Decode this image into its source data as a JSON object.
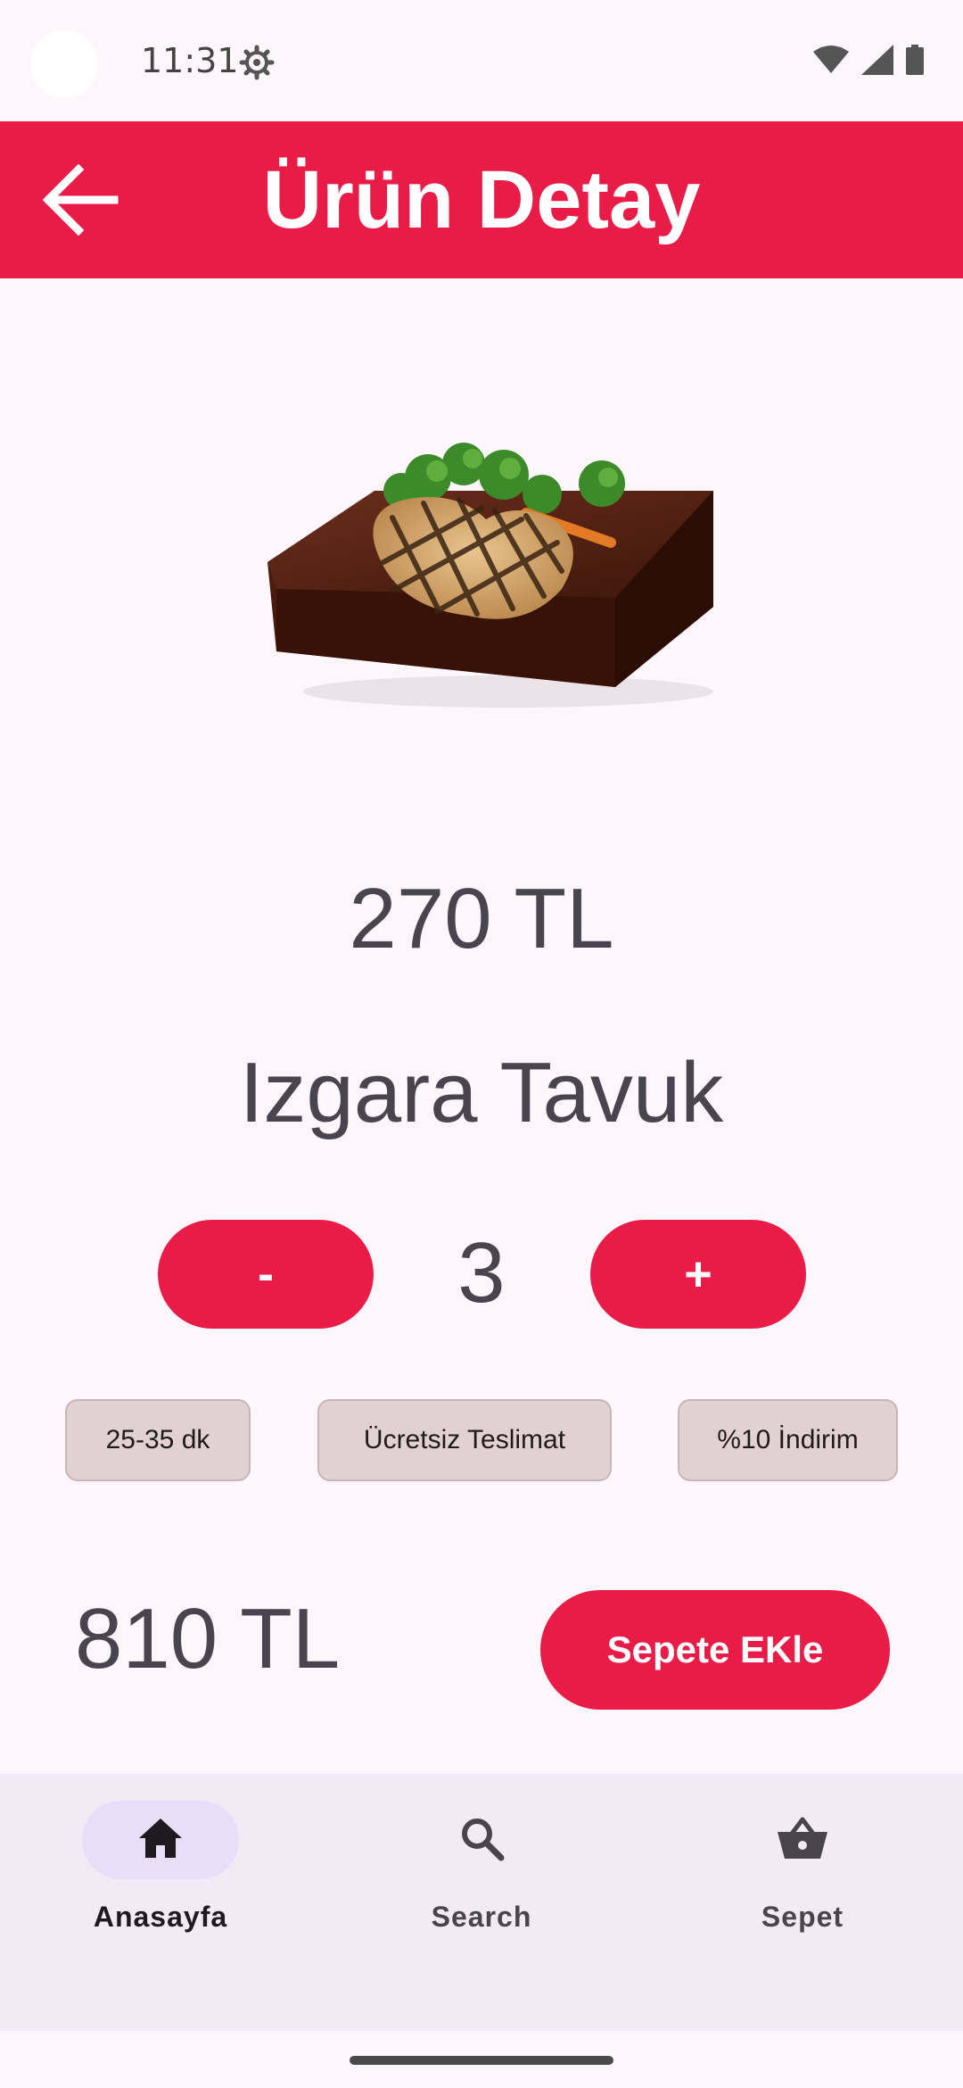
{
  "status_bar": {
    "time": "11:31"
  },
  "app_bar": {
    "title": "Ürün Detay"
  },
  "product": {
    "price": "270 TL",
    "name": "Izgara Tavuk",
    "quantity": "3"
  },
  "stepper": {
    "minus_label": "-",
    "plus_label": "+"
  },
  "chips": [
    {
      "label": "25-35 dk"
    },
    {
      "label": "Ücretsiz Teslimat"
    },
    {
      "label": "%10 İndirim"
    }
  ],
  "total": "810 TL",
  "add_to_cart_label": "Sepete EKle",
  "bottom_nav": {
    "items": [
      {
        "label": "Anasayfa",
        "icon": "home-icon",
        "selected": true
      },
      {
        "label": "Search",
        "icon": "search-icon",
        "selected": false
      },
      {
        "label": "Sepet",
        "icon": "basket-icon",
        "selected": false
      }
    ]
  },
  "colors": {
    "accent": "#e91b47",
    "background": "#fdf7fb",
    "chip": "#e2d1d2",
    "nav_background": "#f2ebf5",
    "nav_indicator": "#e8def8",
    "text": "#49454f"
  }
}
